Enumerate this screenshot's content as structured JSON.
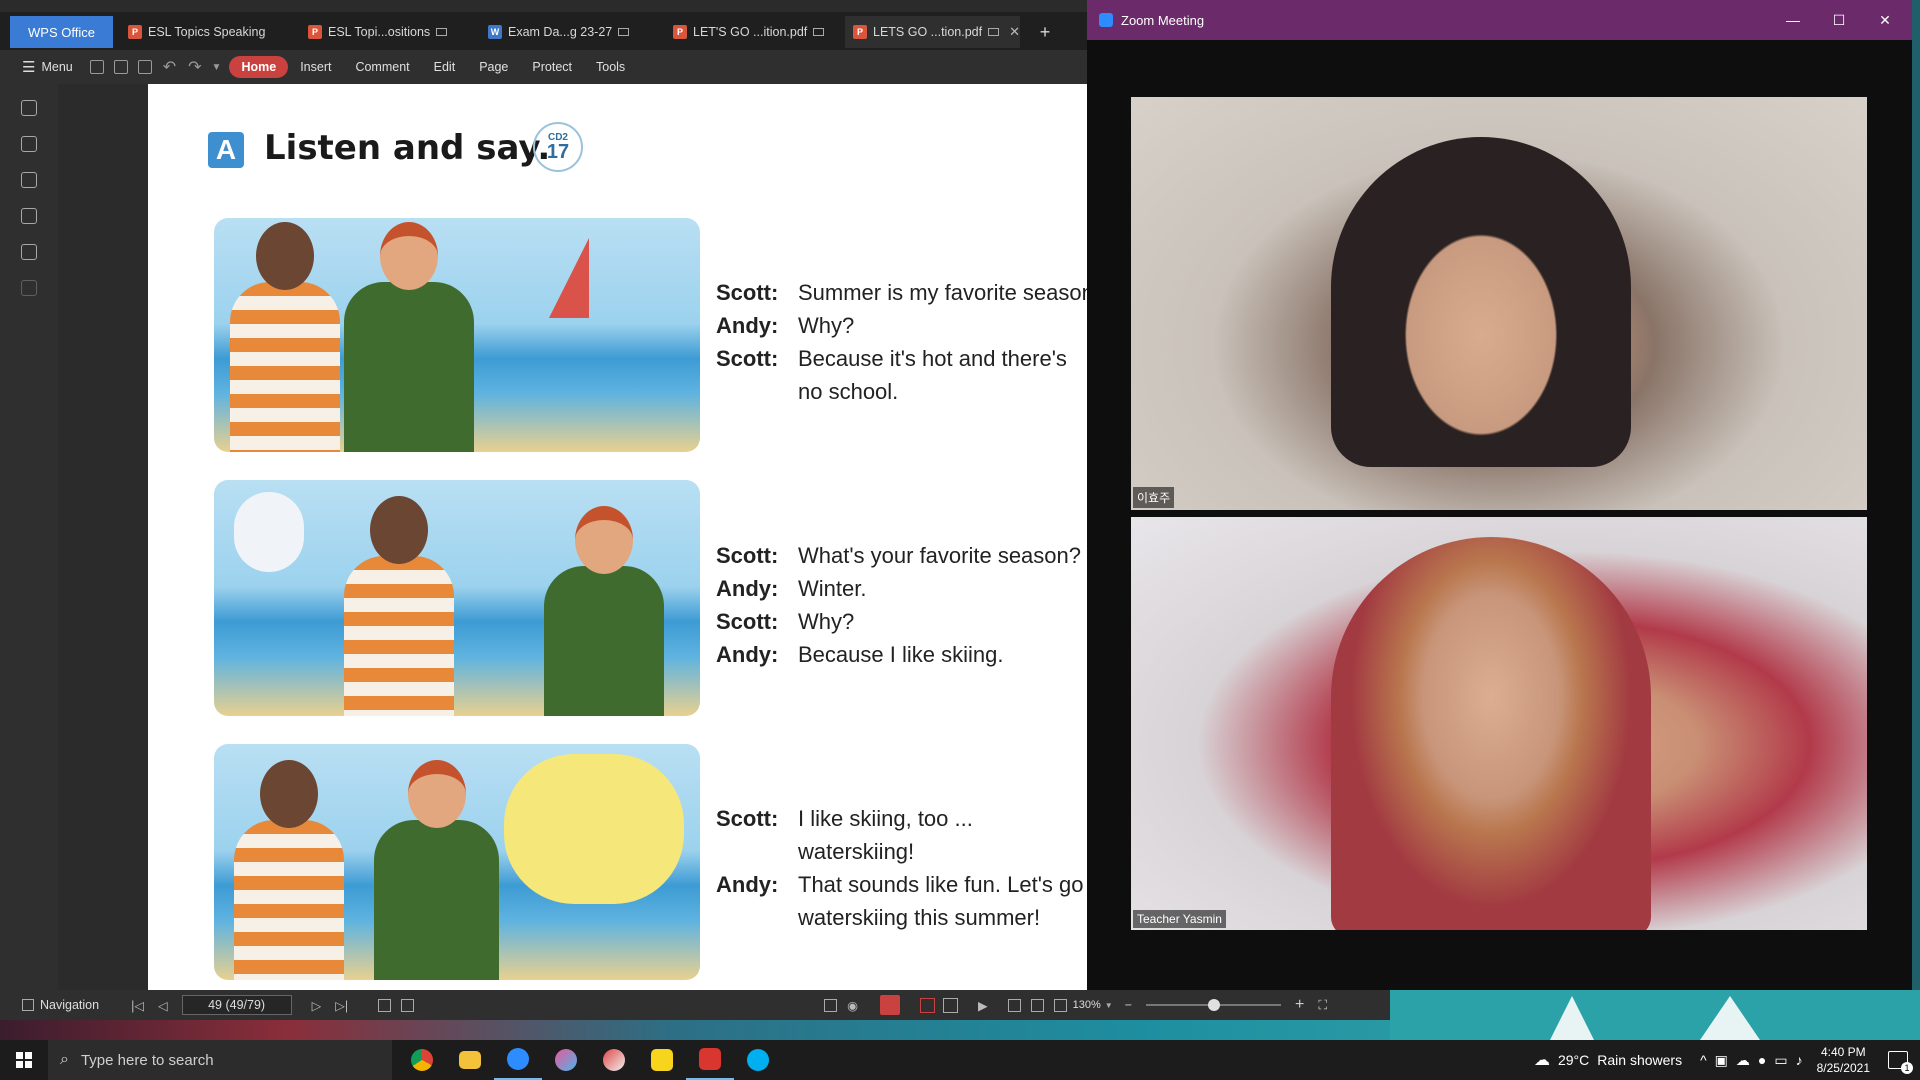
{
  "wps": {
    "tabs": [
      {
        "label": "WPS Office"
      },
      {
        "label": "ESL Topics Speaking"
      },
      {
        "label": "ESL Topi...ositions"
      },
      {
        "label": "Exam Da...g 23-27"
      },
      {
        "label": "LET'S GO ...ition.pdf"
      },
      {
        "label": "LETS GO ...tion.pdf"
      }
    ],
    "new_tab": "+",
    "close": "✕",
    "menu_label": "Menu",
    "ribbon": [
      "Home",
      "Insert",
      "Comment",
      "Edit",
      "Page",
      "Protect",
      "Tools"
    ],
    "status": {
      "navigation": "Navigation",
      "page": "49 (49/79)",
      "zoom": "130%",
      "zoom_fraction": 0.5
    }
  },
  "document": {
    "section_letter": "A",
    "section_title": "Listen and say.",
    "cd_label": "CD2",
    "cd_track": "17",
    "dialogues": [
      [
        {
          "speaker": "Scott:",
          "text": "Summer is my favorite season"
        },
        {
          "speaker": "Andy:",
          "text": "Why?"
        },
        {
          "speaker": "Scott:",
          "text": "Because it's hot and there's"
        },
        {
          "speaker": "",
          "text": "no school."
        }
      ],
      [
        {
          "speaker": "Scott:",
          "text": "What's your favorite season?"
        },
        {
          "speaker": "Andy:",
          "text": "Winter."
        },
        {
          "speaker": "Scott:",
          "text": "Why?"
        },
        {
          "speaker": "Andy:",
          "text": "Because I like skiing."
        }
      ],
      [
        {
          "speaker": "Scott:",
          "text": "I like skiing, too ..."
        },
        {
          "speaker": "",
          "text": "waterskiing!"
        },
        {
          "speaker": "Andy:",
          "text": "That sounds like fun. Let's go"
        },
        {
          "speaker": "",
          "text": "waterskiing this summer!"
        }
      ]
    ]
  },
  "zoom": {
    "title": "Zoom Meeting",
    "participant1_label": "이효주",
    "participant2_label": "Teacher Yasmin"
  },
  "taskbar": {
    "search_placeholder": "Type here to search",
    "weather_temp": "29°C",
    "weather_text": "Rain showers",
    "time": "4:40 PM",
    "date": "8/25/2021",
    "notification_count": "1"
  }
}
